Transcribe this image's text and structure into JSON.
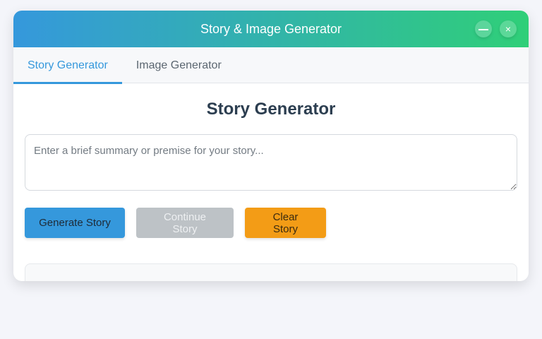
{
  "window": {
    "title": "Story & Image Generator",
    "minimize_symbol": "—",
    "close_symbol": "×"
  },
  "tabs": [
    {
      "label": "Story Generator",
      "active": true
    },
    {
      "label": "Image Generator",
      "active": false
    }
  ],
  "main": {
    "heading": "Story Generator",
    "prompt": {
      "value": "",
      "placeholder": "Enter a brief summary or premise for your story..."
    },
    "buttons": {
      "generate": "Generate Story",
      "continue": "Continue Story",
      "clear": "Clear Story"
    }
  },
  "colors": {
    "gradient_start": "#3598dc",
    "gradient_end": "#2fcf78",
    "accent": "#3598dc",
    "clear": "#f39c16",
    "disabled": "#bdc2c6"
  },
  "icons": {
    "minimize": "minimize-icon",
    "close": "close-icon"
  }
}
